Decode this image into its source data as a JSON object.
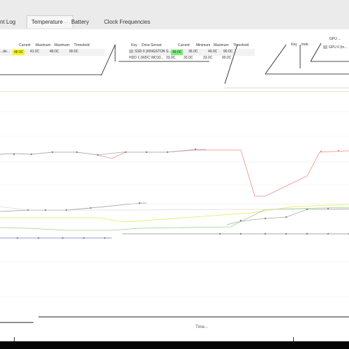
{
  "tabs": [
    {
      "label": "nt Log"
    },
    {
      "label": "Temperature",
      "suffix": "···",
      "active": true
    },
    {
      "label": "Battery"
    },
    {
      "label": "Clock Frequencies"
    }
  ],
  "cpu_table": {
    "headers": [
      "Current",
      "Maximum",
      "Maximum",
      "Threshold"
    ],
    "row": {
      "name": "...de...",
      "current": "48.0C",
      "minimum": "41.0C",
      "maximum": "48.0C",
      "threshold": "90.0C"
    }
  },
  "drive_table": {
    "headers": [
      "Key",
      "Drive Sensor",
      "Current",
      "Minimum",
      "Maximum",
      "Threshold"
    ],
    "rows": [
      {
        "name": "SSD 0 (KINGSTON S...",
        "current": "49.0C",
        "minimum": "36.0C",
        "maximum": "49.0C",
        "threshold": "90.0C",
        "highlight": "green"
      },
      {
        "name": "HDD 1 (WDC WD10...",
        "current": "33.0C",
        "minimum": "33.0C",
        "maximum": "33.0C",
        "threshold": "90.0C",
        "highlight": "none"
      }
    ]
  },
  "gpu_table": {
    "headers": [
      "Key",
      "Inde",
      "GPU ..."
    ],
    "row": {
      "name": "GPU 0 (In..."
    }
  },
  "chart": {
    "time_label": "Time",
    "time_suffix": "...",
    "colors": {
      "pink": "#f08a8a",
      "gray": "#999999",
      "yellow": "#e8e850",
      "green": "#9ad28c",
      "blue": "#7070c8",
      "olive": "#c8c88c",
      "light_gray": "#cccccc"
    }
  }
}
